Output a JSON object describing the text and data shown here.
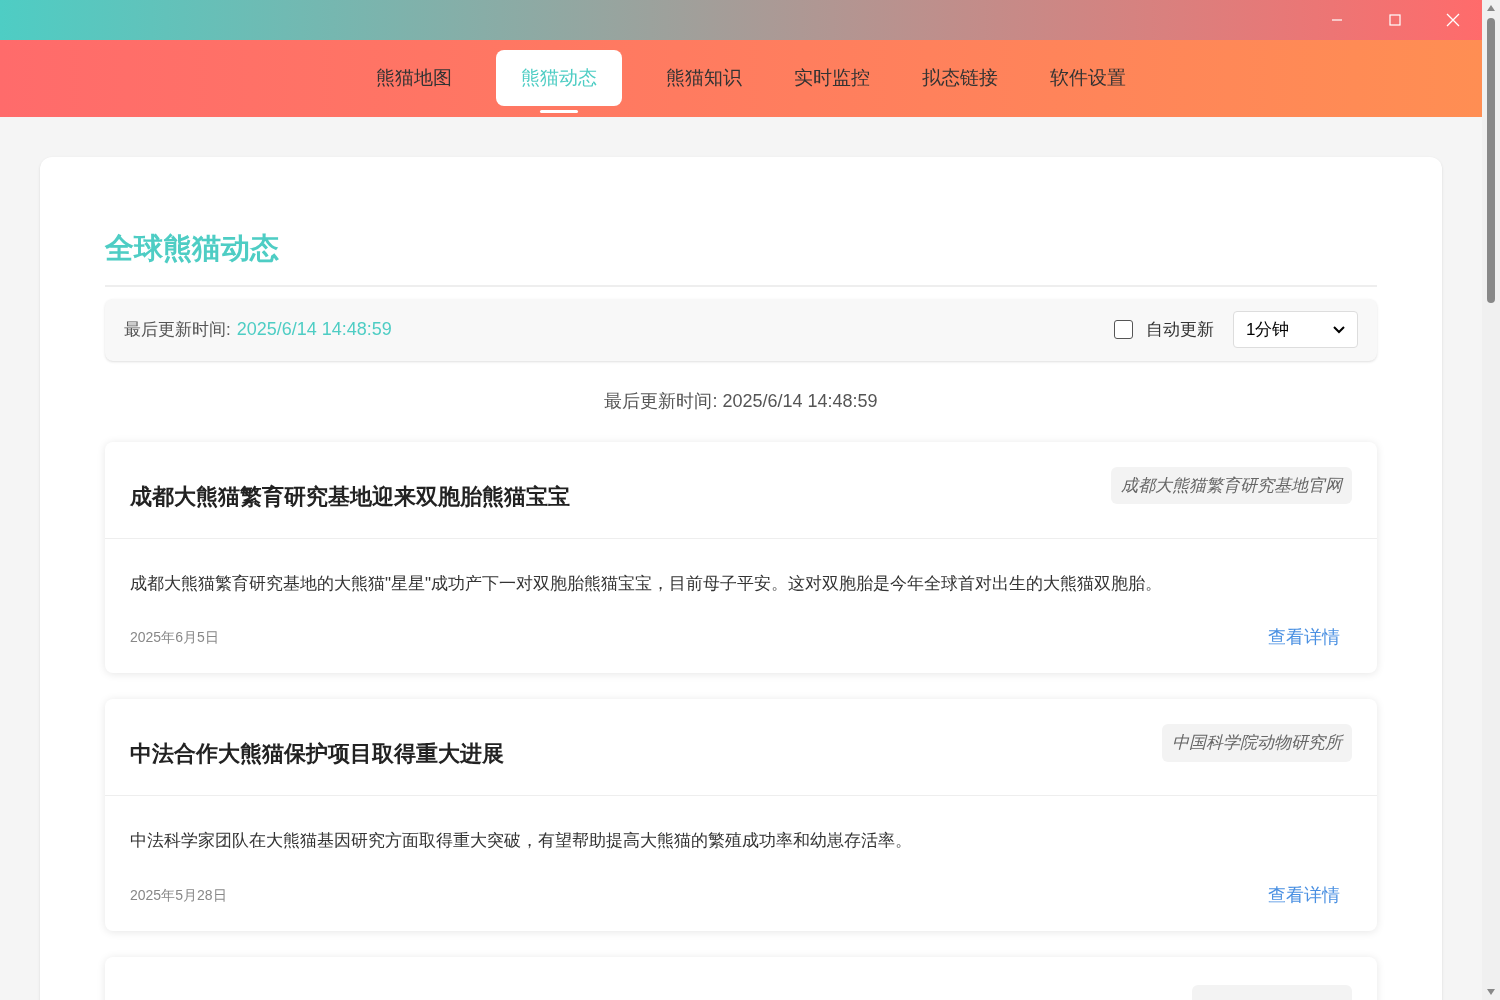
{
  "nav_tabs": [
    {
      "label": "熊猫地图",
      "selected": false
    },
    {
      "label": "熊猫动态",
      "selected": true
    },
    {
      "label": "熊猫知识",
      "selected": false
    },
    {
      "label": "实时监控",
      "selected": false
    },
    {
      "label": "拟态链接",
      "selected": false
    },
    {
      "label": "软件设置",
      "selected": false
    }
  ],
  "page_title": "全球熊猫动态",
  "update_bar": {
    "label": "最后更新时间:",
    "time": "2025/6/14 14:48:59",
    "auto_update": {
      "label": "自动更新",
      "checked": false
    },
    "interval": "1分钟"
  },
  "last_updated": "最后更新时间: 2025/6/14 14:48:59",
  "news": [
    {
      "title": "成都大熊猫繁育研究基地迎来双胞胎熊猫宝宝",
      "source": "成都大熊猫繁育研究基地官网",
      "summary": "成都大熊猫繁育研究基地的大熊猫\"星星\"成功产下一对双胞胎熊猫宝宝，目前母子平安。这对双胞胎是今年全球首对出生的大熊猫双胞胎。",
      "date": "2025年6月5日",
      "link": "查看详情"
    },
    {
      "title": "中法合作大熊猫保护项目取得重大进展",
      "source": "中国科学院动物研究所",
      "summary": "中法科学家团队在大熊猫基因研究方面取得重大突破，有望帮助提高大熊猫的繁殖成功率和幼崽存活率。",
      "date": "2025年5月28日",
      "link": "查看详情"
    }
  ]
}
